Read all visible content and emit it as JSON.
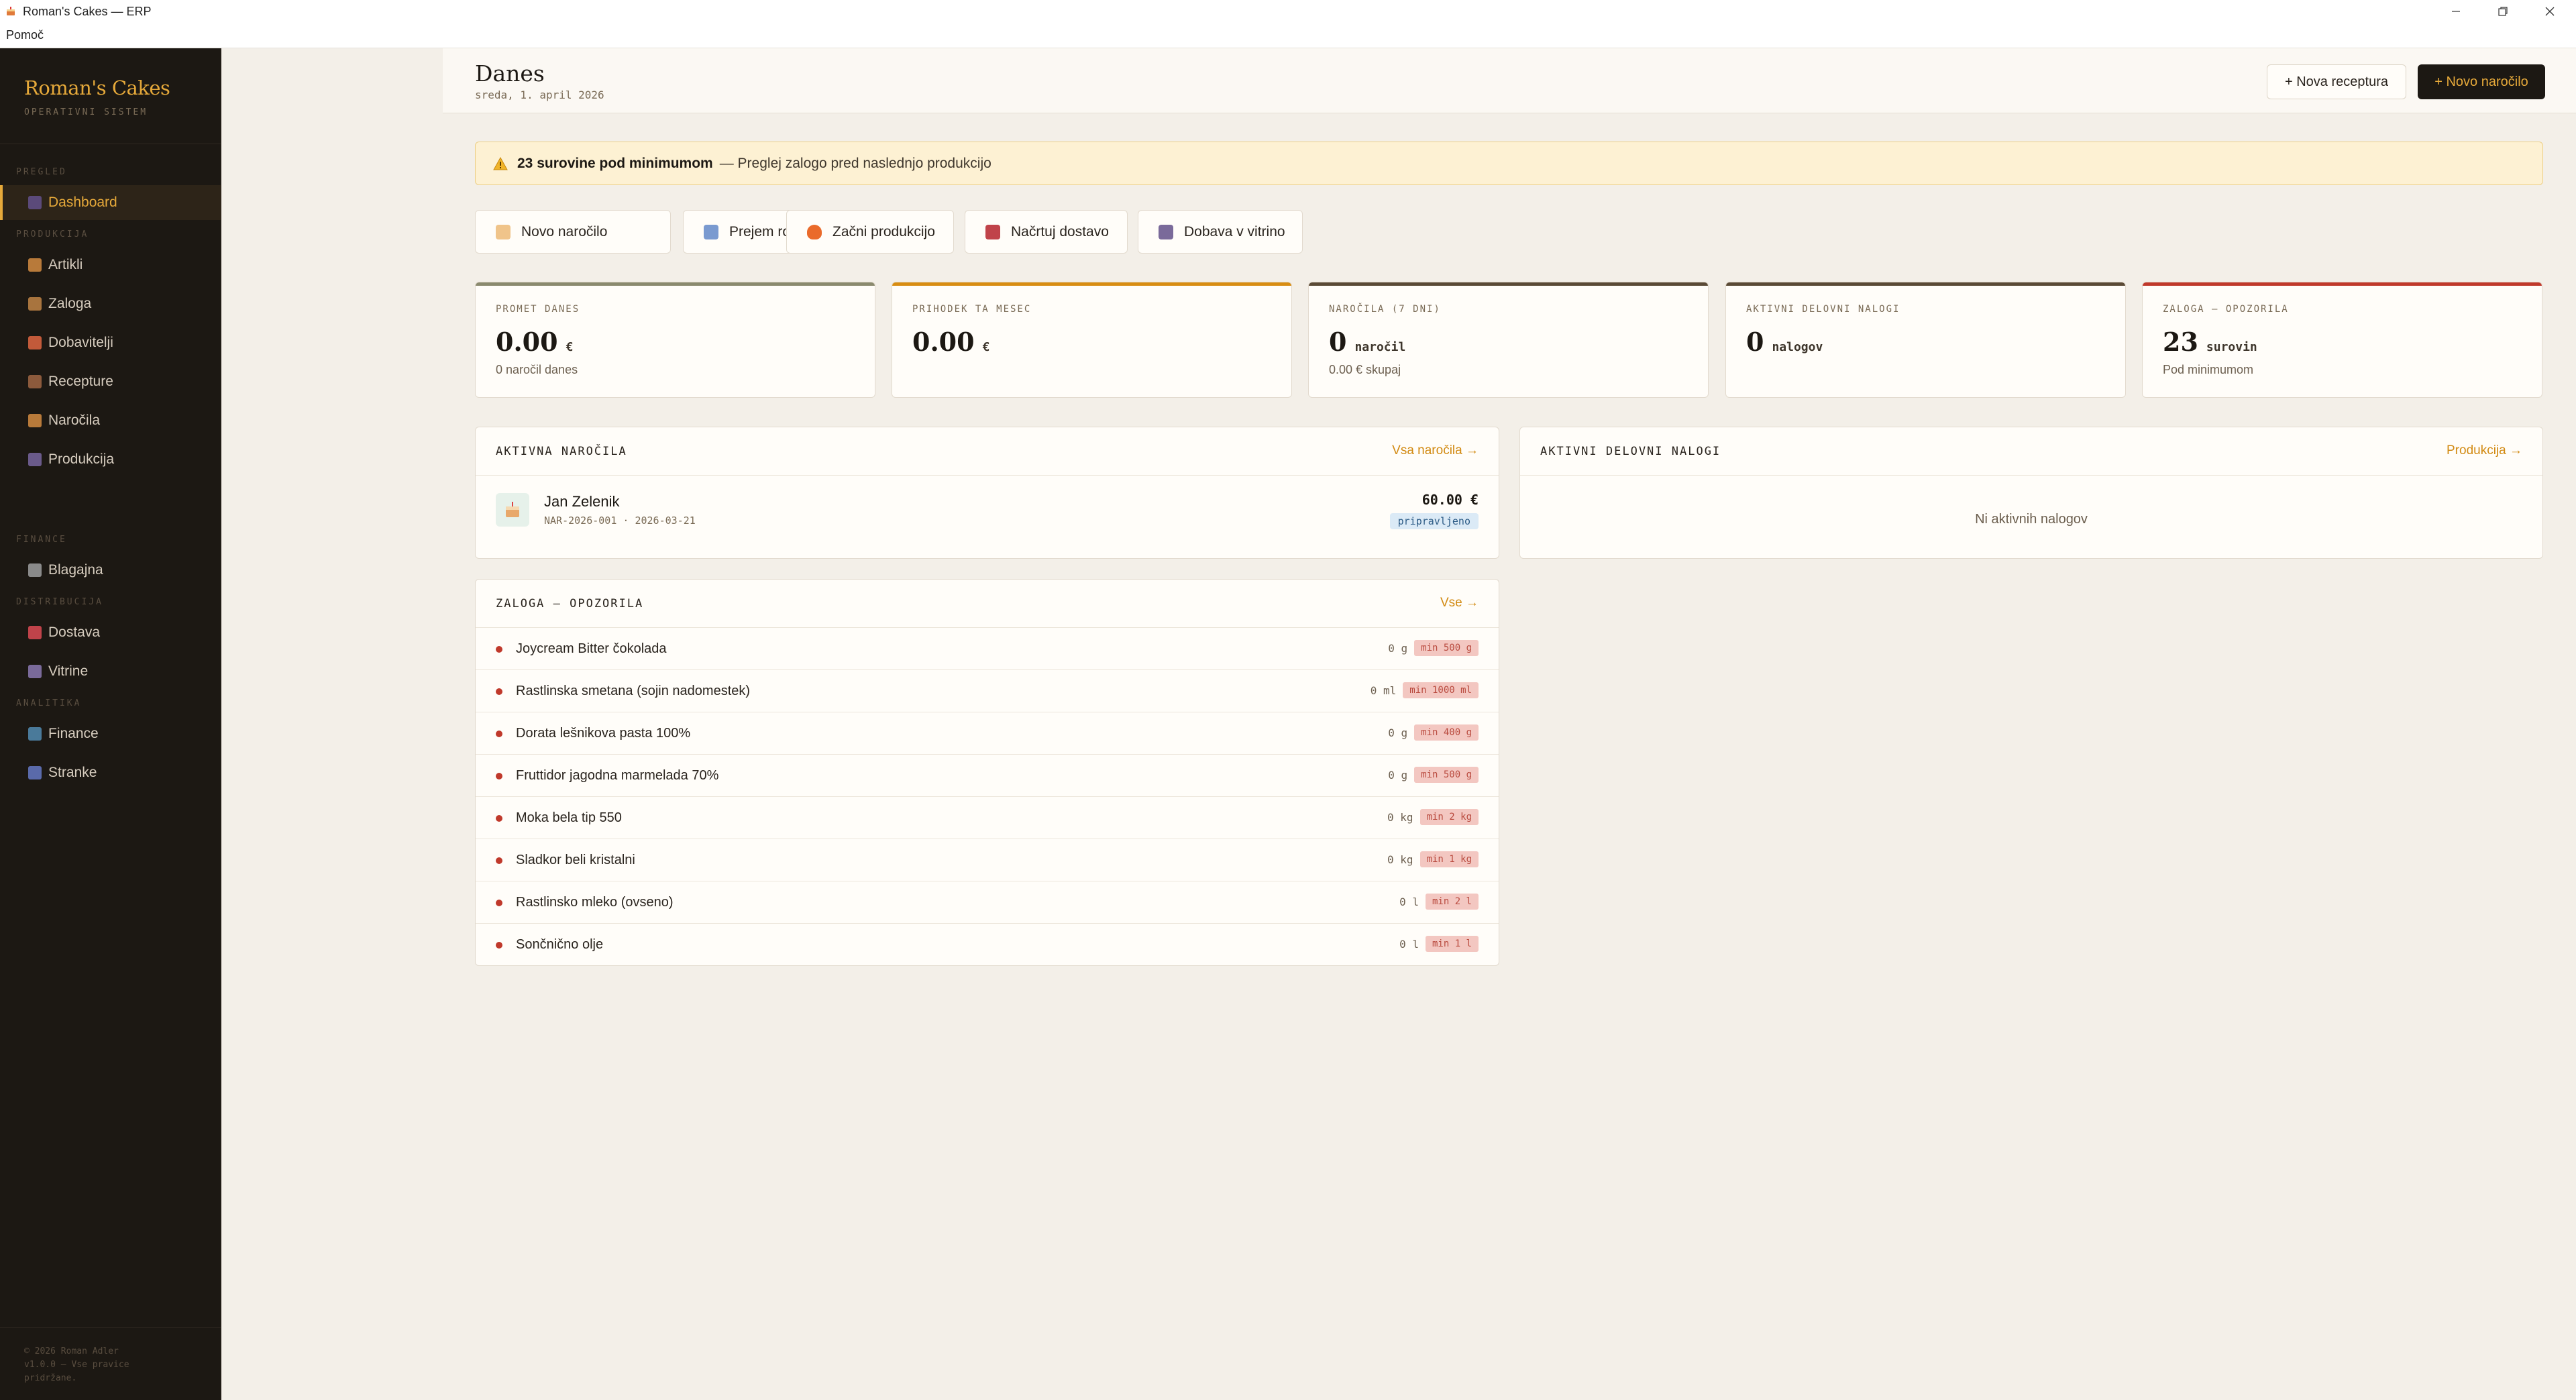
{
  "window": {
    "title": "Roman's Cakes — ERP"
  },
  "menu": {
    "help": "Pomoč"
  },
  "sidebar": {
    "brand": "Roman's Cakes",
    "brand_sub": "OPERATIVNI SISTEM",
    "sections": {
      "pregled": "PREGLED",
      "produkcija": "PRODUKCIJA",
      "finance": "FINANCE",
      "distribucija": "DISTRIBUCIJA",
      "analitika": "ANALITIKA"
    },
    "items": [
      {
        "label": "Dashboard",
        "icon": "dashboard-icon",
        "active": true
      },
      {
        "label": "Artikli",
        "icon": "basket-icon"
      },
      {
        "label": "Zaloga",
        "icon": "box-icon"
      },
      {
        "label": "Dobavitelji",
        "icon": "truck-icon"
      },
      {
        "label": "Recepture",
        "icon": "book-icon"
      },
      {
        "label": "Naročila",
        "icon": "basket-icon"
      },
      {
        "label": "Produkcija",
        "icon": "factory-icon"
      },
      {
        "label": "Blagajna",
        "icon": "register-icon"
      },
      {
        "label": "Dostava",
        "icon": "car-icon"
      },
      {
        "label": "Vitrine",
        "icon": "cabinet-icon"
      },
      {
        "label": "Finance",
        "icon": "chart-icon"
      },
      {
        "label": "Stranke",
        "icon": "users-icon"
      }
    ],
    "footer": [
      "© 2026 Roman Adler",
      "v1.0.0 — Vse pravice",
      "pridržane."
    ]
  },
  "header": {
    "title": "Danes",
    "date": "sreda, 1. april 2026",
    "new_recipe": "+ Nova receptura",
    "new_order": "+ Novo naročilo"
  },
  "alert": {
    "bold": "23 surovine pod minimumom",
    "rest": "— Preglej zalogo pred naslednjo produkcijo"
  },
  "quick_actions": [
    {
      "label": "Novo naročilo",
      "icon": "cake-icon"
    },
    {
      "label": "Prejem robe",
      "icon": "package-icon"
    },
    {
      "label": "Začni produkcijo",
      "icon": "fire-icon"
    },
    {
      "label": "Načrtuj dostavo",
      "icon": "car-icon"
    },
    {
      "label": "Dobava v vitrino",
      "icon": "cabinet-icon"
    }
  ],
  "stats": [
    {
      "label": "PROMET DANES",
      "value": "0.00",
      "unit": "€",
      "sub": "0 naročil danes",
      "color": "#8a8a6e"
    },
    {
      "label": "PRIHODEK TA MESEC",
      "value": "0.00",
      "unit": "€",
      "sub": "",
      "color": "#d88d12"
    },
    {
      "label": "NAROČILA (7 DNI)",
      "value": "0",
      "unit": "naročil",
      "sub": "0.00 € skupaj",
      "color": "#5a4a36"
    },
    {
      "label": "AKTIVNI DELOVNI NALOGI",
      "value": "0",
      "unit": "nalogov",
      "sub": "",
      "color": "#5a4a36"
    },
    {
      "label": "ZALOGA — OPOZORILA",
      "value": "23",
      "unit": "surovin",
      "sub": "Pod minimumom",
      "color": "#c0392b"
    }
  ],
  "orders_panel": {
    "title": "AKTIVNA NAROČILA",
    "link": "Vsa naročila →",
    "order": {
      "name": "Jan Zelenik",
      "meta": "NAR-2026-001 · 2026-03-21",
      "amount": "60.00 €",
      "status": "pripravljeno"
    }
  },
  "work_orders_panel": {
    "title": "AKTIVNI DELOVNI NALOGI",
    "link": "Produkcija →",
    "empty": "Ni aktivnih nalogov"
  },
  "stock_panel": {
    "title": "ZALOGA — OPOZORILA",
    "link": "Vse →",
    "items": [
      {
        "name": "Joycream Bitter čokolada",
        "qty": "0 g",
        "min": "min 500 g"
      },
      {
        "name": "Rastlinska smetana (sojin nadomestek)",
        "qty": "0 ml",
        "min": "min 1000 ml"
      },
      {
        "name": "Dorata lešnikova pasta 100%",
        "qty": "0 g",
        "min": "min 400 g"
      },
      {
        "name": "Fruttidor jagodna marmelada 70%",
        "qty": "0 g",
        "min": "min 500 g"
      },
      {
        "name": "Moka bela tip 550",
        "qty": "0 kg",
        "min": "min 2 kg"
      },
      {
        "name": "Sladkor beli kristalni",
        "qty": "0 kg",
        "min": "min 1 kg"
      },
      {
        "name": "Rastlinsko mleko (ovseno)",
        "qty": "0 l",
        "min": "min 2 l"
      },
      {
        "name": "Sončnično olje",
        "qty": "0 l",
        "min": "min 1 l"
      }
    ]
  }
}
